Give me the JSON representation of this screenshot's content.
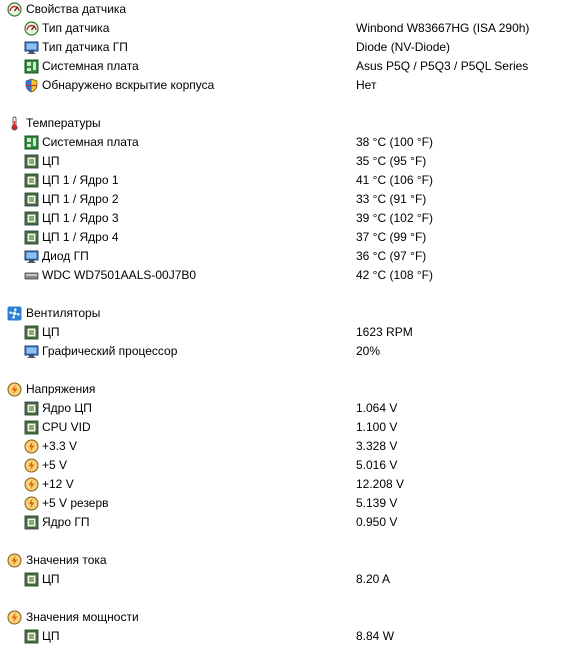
{
  "sections": [
    {
      "title": "Свойства датчика",
      "icon": "sensor-gauge-icon",
      "items": [
        {
          "label": "Тип датчика",
          "value": "Winbond W83667HG  (ISA 290h)",
          "icon": "sensor-gauge-icon"
        },
        {
          "label": "Тип датчика ГП",
          "value": "Diode  (NV-Diode)",
          "icon": "monitor-icon"
        },
        {
          "label": "Системная плата",
          "value": "Asus P5Q / P5Q3 / P5QL Series",
          "icon": "motherboard-icon"
        },
        {
          "label": "Обнаружено вскрытие корпуса",
          "value": "Нет",
          "icon": "shield-icon"
        }
      ]
    },
    {
      "title": "Температуры",
      "icon": "thermometer-icon",
      "items": [
        {
          "label": "Системная плата",
          "value": "38 °C  (100 °F)",
          "icon": "motherboard-icon"
        },
        {
          "label": "ЦП",
          "value": "35 °C  (95 °F)",
          "icon": "cpu-chip-icon"
        },
        {
          "label": "ЦП 1 / Ядро 1",
          "value": "41 °C  (106 °F)",
          "icon": "cpu-chip-icon"
        },
        {
          "label": "ЦП 1 / Ядро 2",
          "value": "33 °C  (91 °F)",
          "icon": "cpu-chip-icon"
        },
        {
          "label": "ЦП 1 / Ядро 3",
          "value": "39 °C  (102 °F)",
          "icon": "cpu-chip-icon"
        },
        {
          "label": "ЦП 1 / Ядро 4",
          "value": "37 °C  (99 °F)",
          "icon": "cpu-chip-icon"
        },
        {
          "label": "Диод ГП",
          "value": "36 °C  (97 °F)",
          "icon": "monitor-icon"
        },
        {
          "label": "WDC WD7501AALS-00J7B0",
          "value": "42 °C  (108 °F)",
          "icon": "hard-drive-icon"
        }
      ]
    },
    {
      "title": "Вентиляторы",
      "icon": "fan-icon",
      "items": [
        {
          "label": "ЦП",
          "value": "1623 RPM",
          "icon": "cpu-chip-icon"
        },
        {
          "label": "Графический процессор",
          "value": "20%",
          "icon": "monitor-icon"
        }
      ]
    },
    {
      "title": "Напряжения",
      "icon": "voltage-icon",
      "items": [
        {
          "label": "Ядро ЦП",
          "value": "1.064 V",
          "icon": "cpu-chip-icon"
        },
        {
          "label": "CPU VID",
          "value": "1.100 V",
          "icon": "cpu-chip-icon"
        },
        {
          "label": "+3.3 V",
          "value": "3.328 V",
          "icon": "voltage-icon"
        },
        {
          "label": "+5 V",
          "value": "5.016 V",
          "icon": "voltage-icon"
        },
        {
          "label": "+12 V",
          "value": "12.208 V",
          "icon": "voltage-icon"
        },
        {
          "label": "+5 V резерв",
          "value": "5.139 V",
          "icon": "voltage-icon"
        },
        {
          "label": "Ядро ГП",
          "value": "0.950 V",
          "icon": "cpu-chip-icon"
        }
      ]
    },
    {
      "title": "Значения тока",
      "icon": "voltage-icon",
      "items": [
        {
          "label": "ЦП",
          "value": "8.20 A",
          "icon": "cpu-chip-icon"
        }
      ]
    },
    {
      "title": "Значения мощности",
      "icon": "voltage-icon",
      "items": [
        {
          "label": "ЦП",
          "value": "8.84 W",
          "icon": "cpu-chip-icon"
        }
      ]
    }
  ]
}
